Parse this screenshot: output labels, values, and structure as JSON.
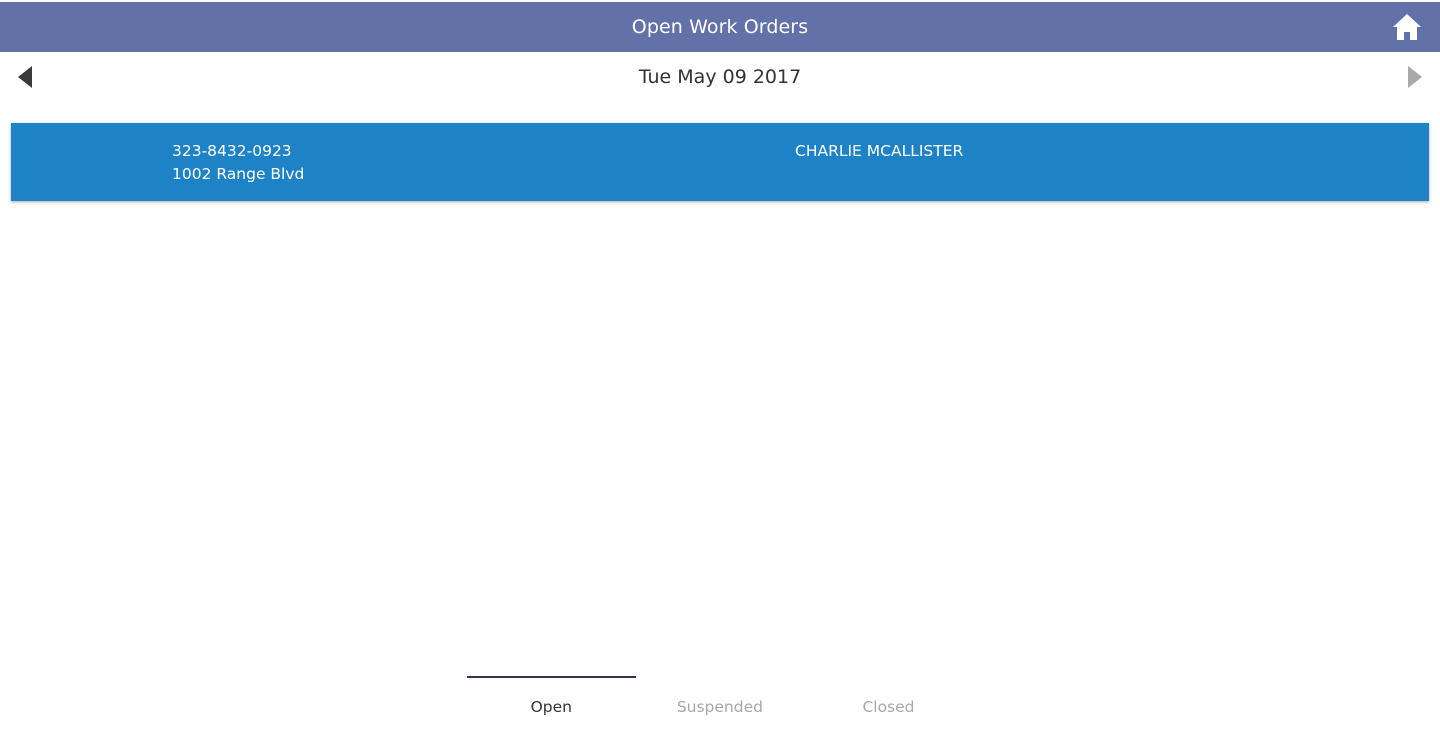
{
  "header": {
    "title": "Open Work Orders",
    "home_icon": "home-icon",
    "color": "#6272a8"
  },
  "date_nav": {
    "date": "Tue May 09 2017",
    "prev_icon": "triangle-left-icon",
    "next_icon": "triangle-right-icon"
  },
  "work_orders": [
    {
      "phone": "323-8432-0923",
      "address": "1002 Range Blvd",
      "customer": "CHARLIE MCALLISTER",
      "color": "#1e83c6"
    }
  ],
  "tabs": [
    {
      "label": "Open",
      "active": true
    },
    {
      "label": "Suspended",
      "active": false
    },
    {
      "label": "Closed",
      "active": false
    }
  ]
}
